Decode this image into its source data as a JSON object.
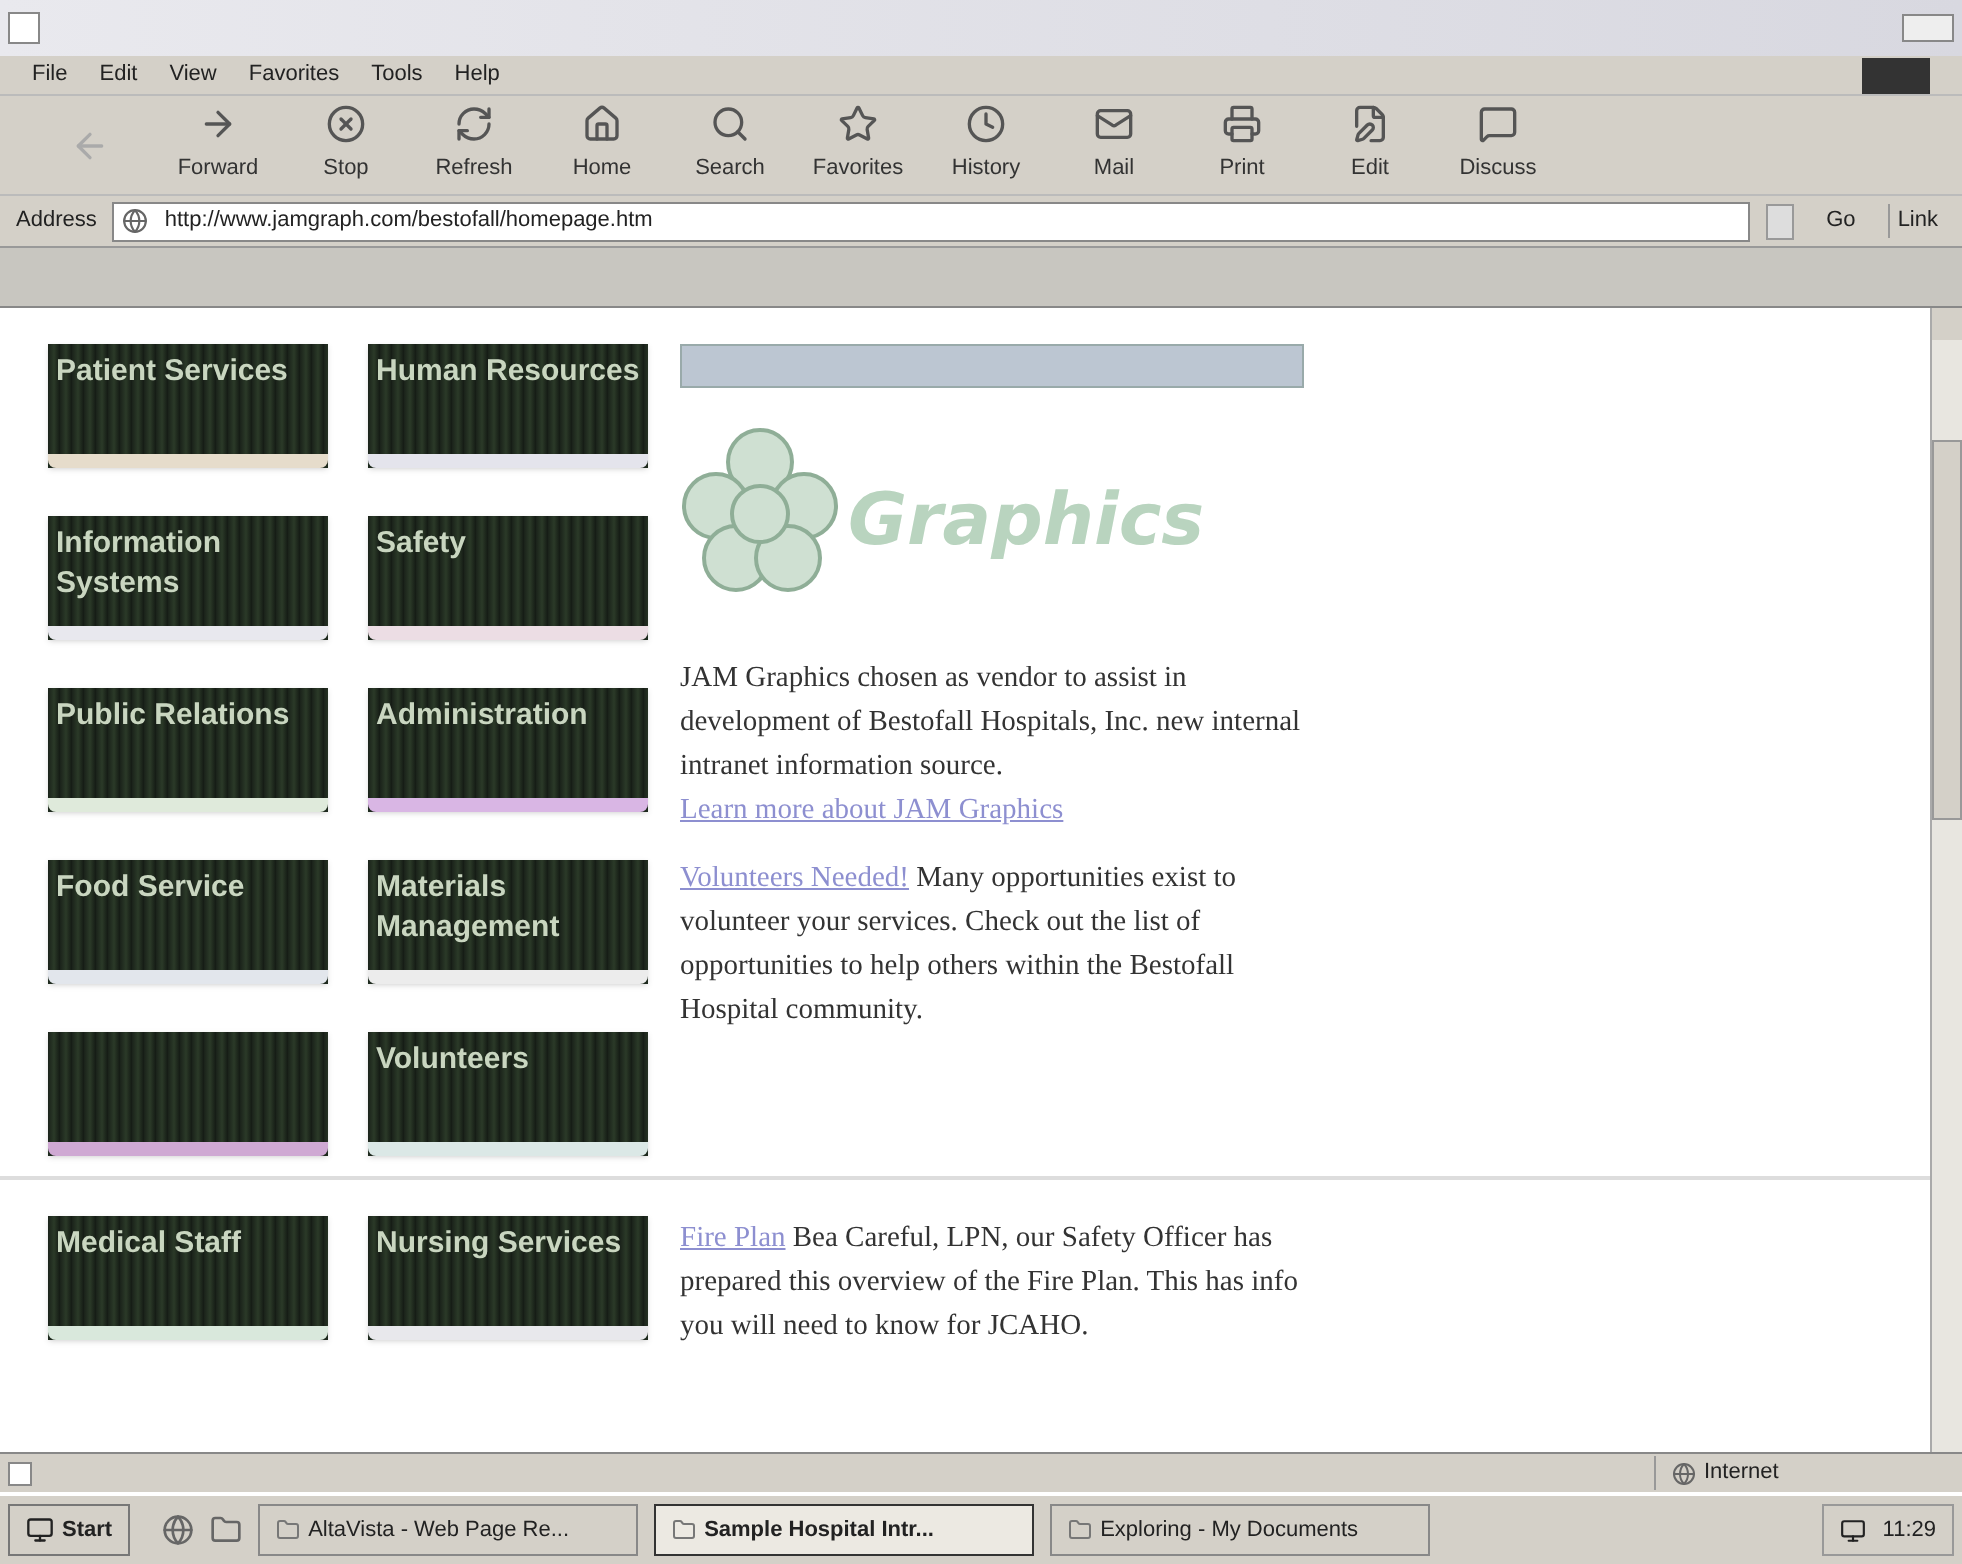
{
  "menu": [
    "File",
    "Edit",
    "View",
    "Favorites",
    "Tools",
    "Help"
  ],
  "toolbar": [
    {
      "disabled": true
    },
    {
      "label": "Forward",
      "disabled": false
    },
    {
      "label": "Stop",
      "disabled": false
    },
    {
      "label": "Refresh",
      "disabled": false
    },
    {
      "label": "Home",
      "disabled": false
    },
    {
      "label": "Search",
      "disabled": false
    },
    {
      "label": "Favorites",
      "disabled": false
    },
    {
      "label": "History",
      "disabled": false
    },
    {
      "label": "Mail",
      "disabled": false
    },
    {
      "label": "Print",
      "disabled": false
    },
    {
      "label": "Edit",
      "disabled": false
    },
    {
      "label": "Discuss",
      "disabled": false
    }
  ],
  "address": {
    "label": "Address",
    "value": "http://www.jamgraph.com/bestofall/homepage.htm",
    "go": "Go",
    "links": "Link"
  },
  "tiles_top": [
    {
      "label": "Patient Services",
      "color": "#e6dccb"
    },
    {
      "label": "Human Resources",
      "color": "#e4e4ec"
    },
    {
      "label": "Information Systems",
      "color": "#e8e8ee"
    },
    {
      "label": "Safety",
      "color": "#ecdde4"
    },
    {
      "label": "Public Relations",
      "color": "#dfeadb"
    },
    {
      "label": "Administration",
      "color": "#d9b6e4"
    },
    {
      "label": "Food Service",
      "color": "#e2e6ec"
    },
    {
      "label": "Materials Management",
      "color": "#ececec"
    },
    {
      "color": "#cfa9d3"
    },
    {
      "label": "Volunteers",
      "color": "#dbe8e6"
    }
  ],
  "tiles_bottom": [
    {
      "label": "Medical Staff",
      "color": "#d9e8dc"
    },
    {
      "label": "Nursing Services",
      "color": "#e8e8ec"
    }
  ],
  "logo": {
    "text": "Graphics"
  },
  "news": [
    {
      "text": "JAM Graphics chosen as vendor to assist in development of Bestofall Hospitals, Inc. new internal intranet information source.",
      "link": "Learn more about JAM Graphics"
    },
    {
      "link": "Volunteers Needed!",
      "text": "Many opportunities exist to volunteer your services. Check out the list of opportunities to help others within the Bestofall Hospital community."
    }
  ],
  "news_bottom": [
    {
      "link": "Fire Plan",
      "text": "Bea Careful, LPN, our Safety Officer has prepared this overview of the Fire Plan. This has info you will need to know for JCAHO."
    }
  ],
  "status_bar": {
    "zone": "Internet"
  },
  "taskbar": {
    "start": "Start",
    "tasks": [
      {
        "label": "AltaVista - Web Page Re...",
        "selected": false
      },
      {
        "label": "Sample Hospital Intr...",
        "selected": true
      },
      {
        "label": "Exploring - My Documents",
        "selected": false
      }
    ],
    "clock": "11:29"
  }
}
